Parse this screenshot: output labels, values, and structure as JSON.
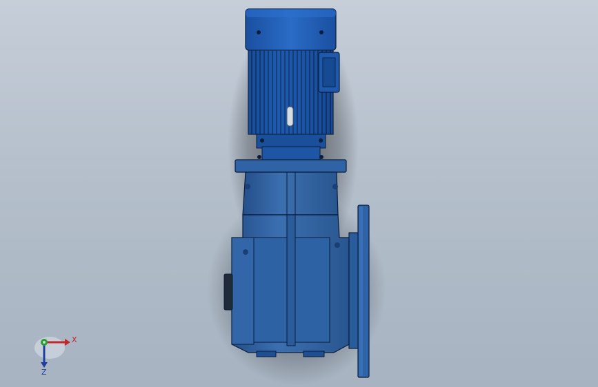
{
  "colors": {
    "background_top": "#c6ced8",
    "background_bottom": "#a7b3c1",
    "motor_blue": "#1a4f9c",
    "housing_blue": "#2f63a6",
    "dark_edge": "#0b1d3a",
    "x_axis": "#c0282b",
    "y_axis": "#2e9a3a",
    "z_axis": "#1f3fa0"
  },
  "triad": {
    "x_label": "X",
    "z_label": "Z"
  }
}
